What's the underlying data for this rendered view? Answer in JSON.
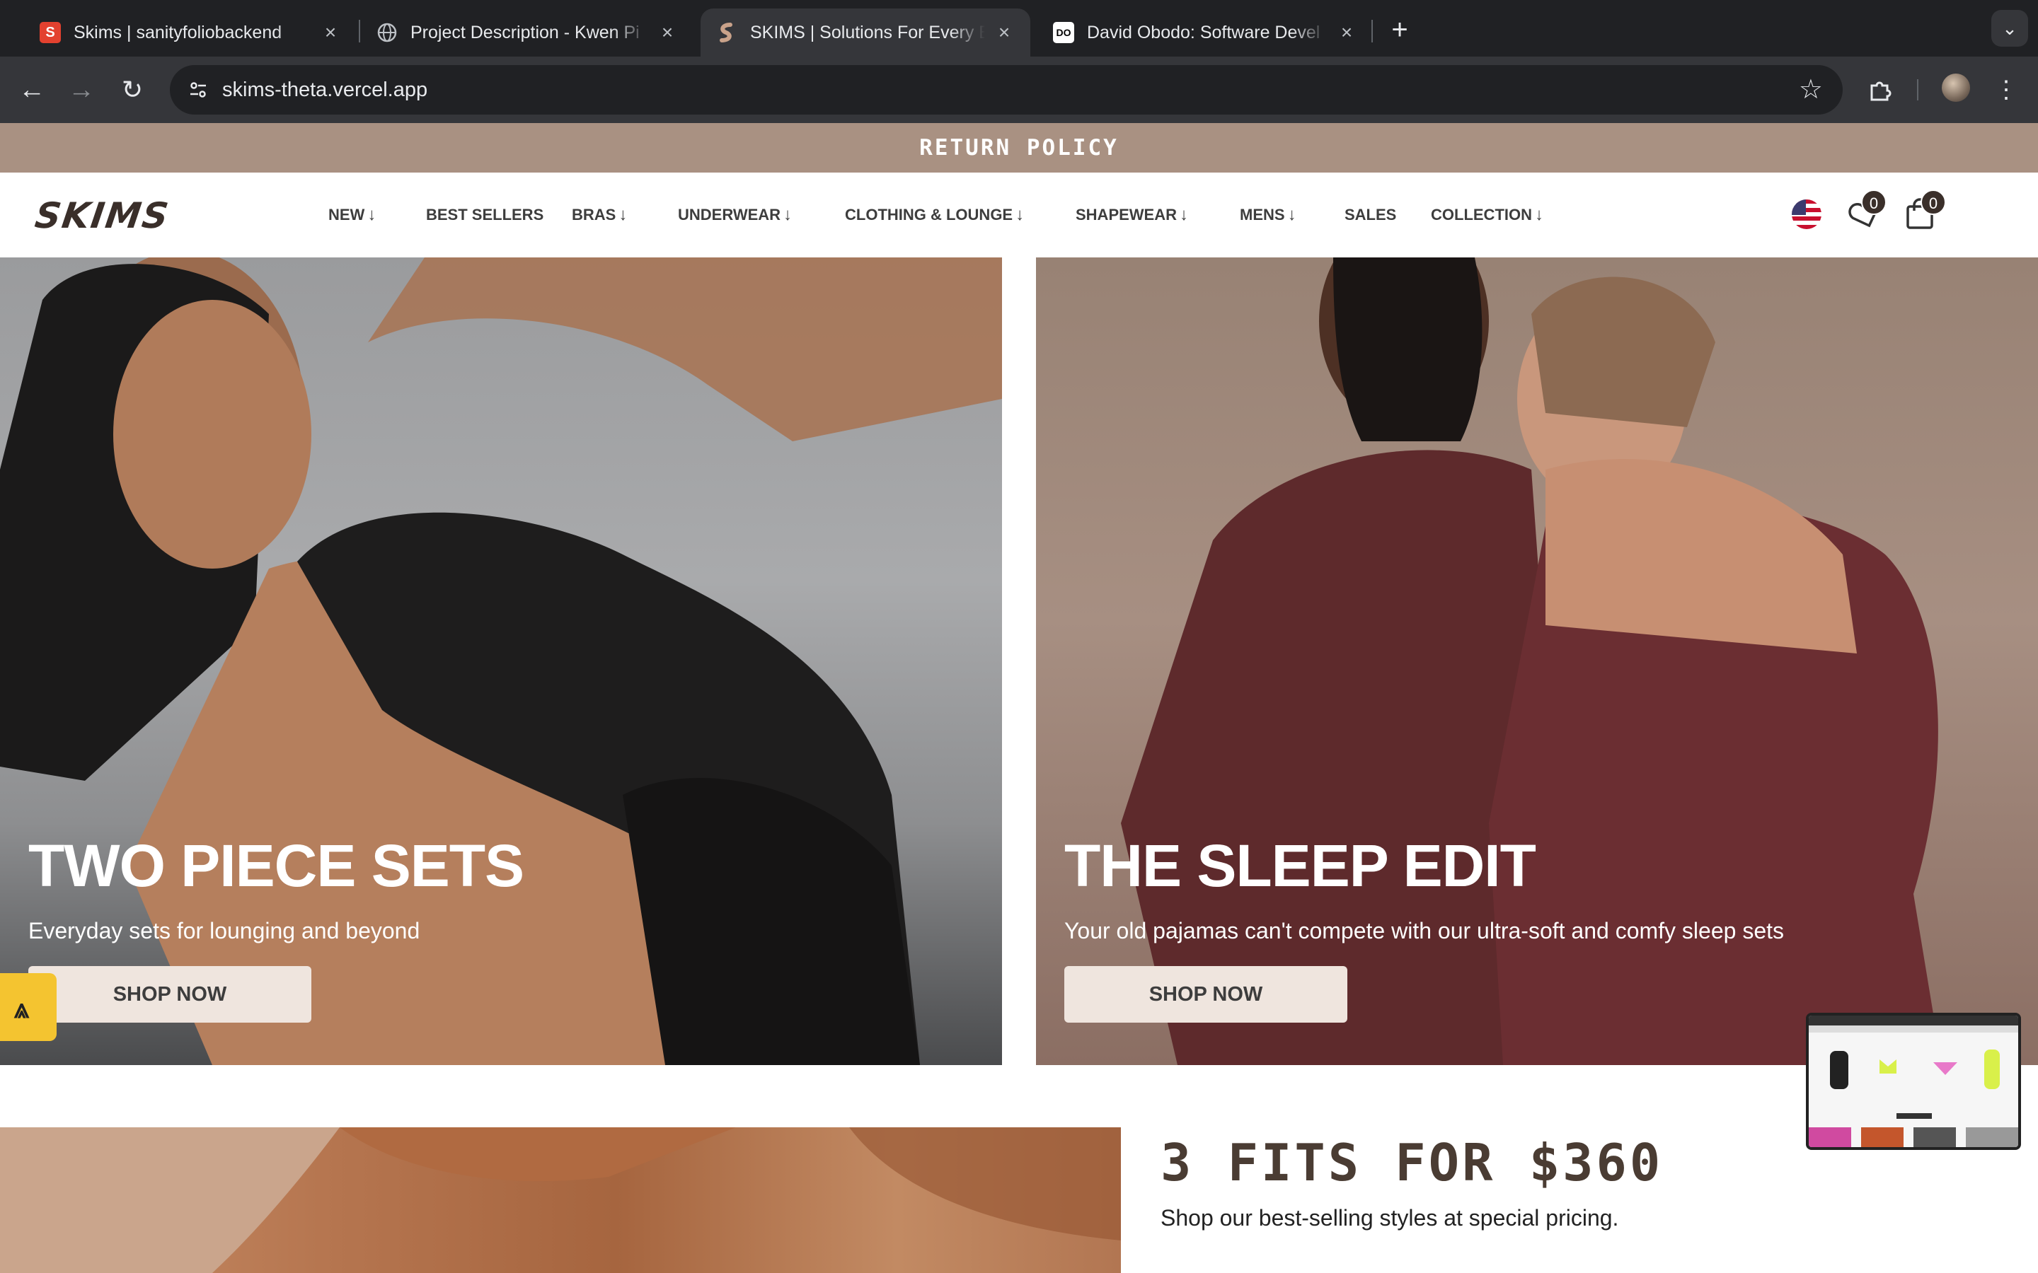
{
  "browser": {
    "tabs": [
      {
        "title": "Skims | sanityfoliobackend",
        "favicon": "S",
        "active": false
      },
      {
        "title": "Project Description - Kwen Pi",
        "favicon": "globe-icon",
        "active": false
      },
      {
        "title": "SKIMS | Solutions For Every B",
        "favicon": "skims-icon",
        "active": true
      },
      {
        "title": "David Obodo: Software Devel",
        "favicon": "DO",
        "active": false
      }
    ],
    "new_tab": "+",
    "url": "skims-theta.vercel.app"
  },
  "site": {
    "announcement": "RETURN POLICY",
    "logo": "SKIMS",
    "nav": [
      {
        "label": "NEW",
        "arrow": "↓"
      },
      {
        "label": "BEST SELLERS",
        "arrow": ""
      },
      {
        "label": "BRAS",
        "arrow": "↓"
      },
      {
        "label": "UNDERWEAR",
        "arrow": "↓"
      },
      {
        "label": "CLOTHING & LOUNGE",
        "arrow": "↓"
      },
      {
        "label": "SHAPEWEAR",
        "arrow": "↓"
      },
      {
        "label": "MENS",
        "arrow": "↓"
      },
      {
        "label": "SALES",
        "arrow": ""
      },
      {
        "label": "COLLECTION",
        "arrow": "↓"
      }
    ],
    "wishlist_count": "0",
    "cart_count": "0",
    "colors": {
      "announcement_bg": "#a99182",
      "button_bg": "#efe5de",
      "brand_text": "#3a2f2a"
    }
  },
  "hero": [
    {
      "title": "TWO PIECE SETS",
      "subtitle": "Everyday sets for lounging and beyond",
      "cta": "SHOP NOW"
    },
    {
      "title": "THE SLEEP EDIT",
      "subtitle": "Your old pajamas can't compete with our ultra-soft and comfy sleep sets",
      "cta": "SHOP NOW"
    }
  ],
  "promo": {
    "title": "3 FITS FOR $360",
    "subtitle": "Shop our best-selling styles at special pricing."
  }
}
